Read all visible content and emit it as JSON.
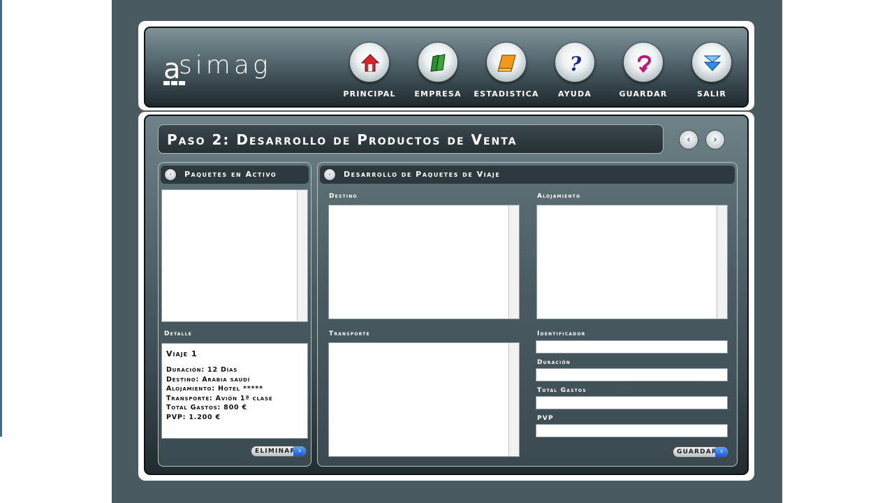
{
  "header": {
    "logo_text": "simag",
    "logo_letter": "a",
    "nav": [
      {
        "label": "PRINCIPAL",
        "icon": "home-icon",
        "color": "#d8262e"
      },
      {
        "label": "EMPRESA",
        "icon": "books-icon",
        "color": "#2e8b2e"
      },
      {
        "label": "ESTADISTICA",
        "icon": "notebook-icon",
        "color": "#f29a16"
      },
      {
        "label": "AYUDA",
        "icon": "question-icon",
        "color": "#1a2a8a"
      },
      {
        "label": "GUARDAR",
        "icon": "save-curl-icon",
        "color": "#c0187a"
      },
      {
        "label": "SALIR",
        "icon": "exit-arrow-icon",
        "color": "#2a8ee8"
      }
    ]
  },
  "step": {
    "title": "Paso 2: Desarrollo de Productos de Venta",
    "prev_icon": "‹",
    "next_icon": "›"
  },
  "left_panel": {
    "title": "Paquetes en Activo",
    "detail_label": "Detalle",
    "detail": {
      "title": "Viaje 1",
      "lines": [
        "Duración: 12 Días",
        "Destino: Arabia saudí",
        "Alojamiento: Hotel *****",
        "Transporte: Avión 1ª clase",
        "Total Gastos: 800 €",
        "PVP: 1.200 €"
      ]
    },
    "delete_button": "ELIMINAR"
  },
  "right_panel": {
    "title": "Desarrollo de Paquetes de Viaje",
    "destino_label": "Destino",
    "alojamiento_label": "Alojamiento",
    "transporte_label": "Transporte",
    "identificador_label": "Identificador",
    "duracion_label": "Duración",
    "total_gastos_label": "Total Gastos",
    "pvp_label": "PVP",
    "save_button": "GUARDAR"
  }
}
